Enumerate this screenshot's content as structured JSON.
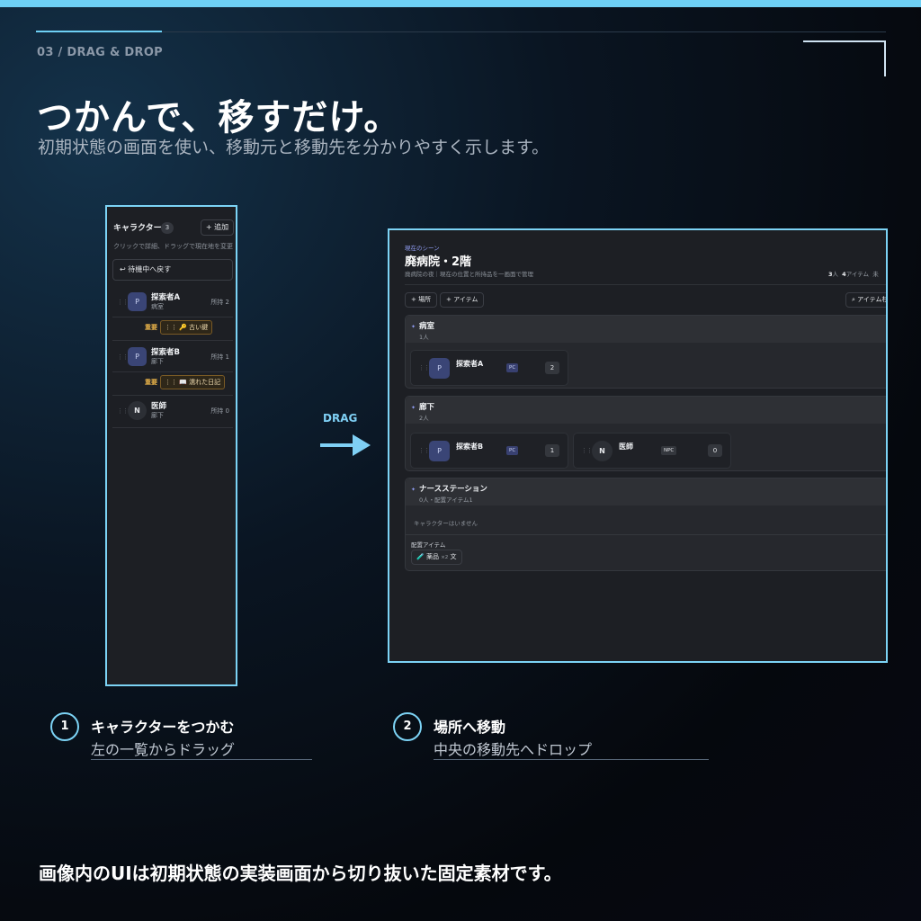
{
  "section": {
    "label": "03  /  DRAG & DROP"
  },
  "hero": {
    "headline": "つかんで、移すだけ。",
    "subline": "初期状態の画面を使い、移動元と移動先を分かりやすく示します。"
  },
  "left_panel": {
    "header": "キャラクター",
    "count": "3",
    "add_label": "+ 追加",
    "hint": "クリックで詳細、ドラッグで現在地を変更",
    "return_label": "↩  待機中へ戻す",
    "characters": [
      {
        "avatar": "P",
        "name": "探索者A",
        "location": "病室",
        "held": "所持 2",
        "tag": "重要",
        "item": "⋮⋮ 🔑 古い鍵"
      },
      {
        "avatar": "P",
        "name": "探索者B",
        "location": "廊下",
        "held": "所持 1",
        "tag": "重要",
        "item": "⋮⋮ 📖 濡れた日記"
      },
      {
        "avatar": "N",
        "name": "医師",
        "location": "廊下",
        "held": "所持 0"
      }
    ]
  },
  "drag": {
    "label": "DRAG"
  },
  "right_panel": {
    "scene_label": "現在のシーン",
    "title": "廃病院・2階",
    "description": "廃病院の夜｜現在の位置と所持品を一画面で管理",
    "stats": {
      "people": "3",
      "people_unit": "人",
      "items": "4",
      "items_unit": "アイテム",
      "extra": "未"
    },
    "buttons": {
      "place": "+ 場所",
      "item": "+ アイテム",
      "item_right": "⌕ アイテム杉"
    },
    "locations": [
      {
        "name": "病室",
        "sub": "1人",
        "people": [
          {
            "avatar": "P",
            "name": "探索者A",
            "badge": "PC",
            "count": "2"
          }
        ]
      },
      {
        "name": "廊下",
        "sub": "2人",
        "people": [
          {
            "avatar": "P",
            "name": "探索者B",
            "badge": "PC",
            "count": "1"
          },
          {
            "avatar": "N",
            "name": "医師",
            "badge": "NPC",
            "count": "0"
          }
        ]
      },
      {
        "name": "ナースステーション",
        "sub": "0人・配置アイテム1",
        "empty_note": "キャラクターはいません",
        "placed_label": "配置アイテム",
        "placed_item": "🧪 薬品",
        "placed_qty": "×2",
        "placed_extra": "文"
      }
    ]
  },
  "steps": [
    {
      "num": "1",
      "title": "キャラクターをつかむ",
      "desc": "左の一覧からドラッグ"
    },
    {
      "num": "2",
      "title": "場所へ移動",
      "desc": "中央の移動先へドロップ"
    }
  ],
  "footer": "画像内のUIは初期状態の実装画面から切り抜いた固定素材です。",
  "colors": {
    "accent": "#6ed0f5",
    "panel": "#1d1f24",
    "pc_badge": "#384070",
    "important": "#e6b048"
  }
}
